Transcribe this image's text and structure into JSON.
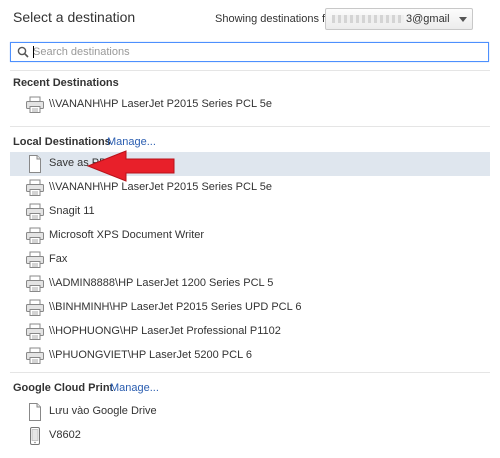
{
  "header": {
    "title": "Select a destination",
    "showing_label": "Showing destinations for",
    "account_visible": "3@gmail"
  },
  "search": {
    "placeholder": "Search destinations",
    "value": ""
  },
  "recent": {
    "title": "Recent Destinations",
    "items": [
      {
        "label": "\\\\VANANH\\HP LaserJet P2015 Series PCL 5e",
        "icon": "printer-icon"
      }
    ]
  },
  "local": {
    "title": "Local Destinations",
    "manage_label": "Manage...",
    "items": [
      {
        "label": "Save as PDF",
        "icon": "document-icon",
        "selected": true
      },
      {
        "label": "\\\\VANANH\\HP LaserJet P2015 Series PCL 5e",
        "icon": "printer-icon"
      },
      {
        "label": "Snagit 11",
        "icon": "printer-icon"
      },
      {
        "label": "Microsoft XPS Document Writer",
        "icon": "printer-icon"
      },
      {
        "label": "Fax",
        "icon": "printer-icon"
      },
      {
        "label": "\\\\ADMIN8888\\HP LaserJet 1200 Series PCL 5",
        "icon": "printer-icon"
      },
      {
        "label": "\\\\BINHMINH\\HP LaserJet P2015 Series UPD PCL 6",
        "icon": "printer-icon"
      },
      {
        "label": "\\\\HOPHUONG\\HP LaserJet Professional P1102",
        "icon": "printer-icon"
      },
      {
        "label": "\\\\PHUONGVIET\\HP LaserJet 5200 PCL 6",
        "icon": "printer-icon"
      }
    ]
  },
  "cloud": {
    "title": "Google Cloud Print",
    "manage_label": "Manage...",
    "items": [
      {
        "label": "Lưu vào Google Drive",
        "icon": "document-icon"
      },
      {
        "label": "V8602",
        "icon": "phone-icon"
      }
    ]
  },
  "colors": {
    "accent": "#4d90fe",
    "link": "#2a5db0",
    "selected_row": "#dfe6ee",
    "annotation_arrow": "#e8202a"
  }
}
